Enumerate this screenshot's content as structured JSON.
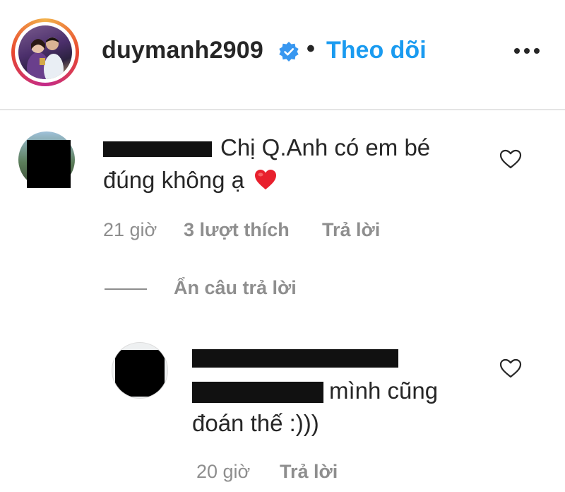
{
  "post": {
    "username": "duymanh2909",
    "separator": "•",
    "follow_label": "Theo dõi"
  },
  "comment": {
    "text_line1": "Chị Q.Anh có em bé",
    "text_line2": "đúng không ạ",
    "emoji": "❤️",
    "time": "21 giờ",
    "likes": "3 lượt thích",
    "reply_label": "Trả lời"
  },
  "hide_replies_label": "Ẩn câu trả lời",
  "reply": {
    "text_line1": "mình cũng",
    "text_line2": "đoán thế :)))",
    "time": "20 giờ",
    "reply_label": "Trả lời"
  },
  "colors": {
    "accent": "#1a9bf0",
    "muted": "#8e8e8e",
    "text": "#262626",
    "heart_emoji": "#e8202d"
  },
  "icons": [
    "verified-badge-icon",
    "more-options-icon",
    "like-heart-icon"
  ]
}
